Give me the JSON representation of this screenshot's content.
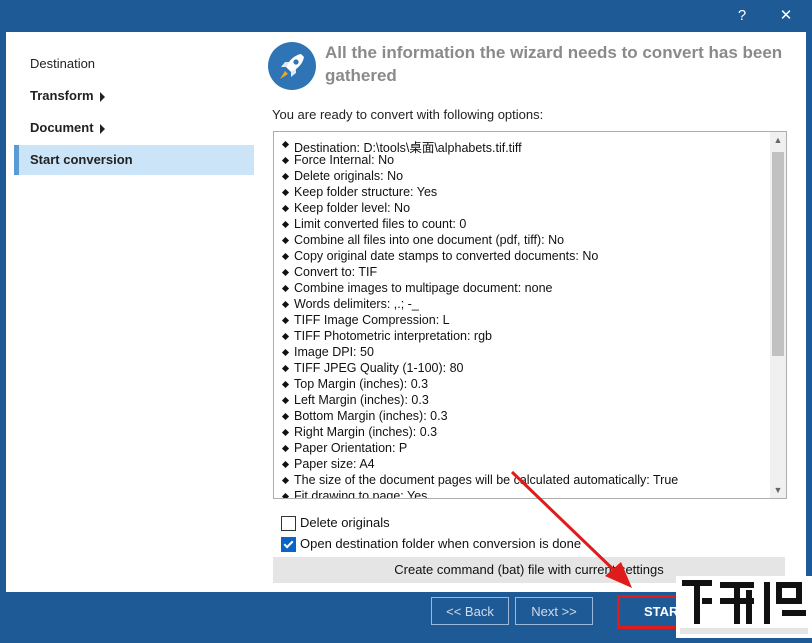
{
  "window": {
    "help_label": "?",
    "close_label": "✕"
  },
  "sidebar": {
    "items": [
      {
        "label": "Destination"
      },
      {
        "label": "Transform"
      },
      {
        "label": "Document"
      },
      {
        "label": "Start conversion"
      }
    ]
  },
  "main": {
    "heading": "All the information the wizard needs to convert has been gathered",
    "subheading": "You are ready to convert with following options:",
    "options": [
      "Destination: D:\\tools\\桌面\\alphabets.tif.tiff",
      "Force Internal: No",
      "Delete originals: No",
      "Keep folder structure: Yes",
      "Keep folder level: No",
      "Limit converted files to count: 0",
      "Combine all files into one document (pdf, tiff): No",
      "Copy original date stamps to converted documents: No",
      "Convert to: TIF",
      "Combine images to multipage document: none",
      "Words delimiters: ,.; -_",
      "TIFF Image Compression: L",
      "TIFF Photometric interpretation: rgb",
      "Image DPI: 50",
      "TIFF JPEG Quality (1-100): 80",
      "Top Margin (inches): 0.3",
      "Left Margin (inches): 0.3",
      "Bottom Margin (inches): 0.3",
      "Right Margin (inches): 0.3",
      "Paper Orientation: P",
      "Paper size: A4",
      "The size of the document pages will be calculated automatically: True",
      "Fit drawing to page: Yes"
    ],
    "delete_originals_label": "Delete originals",
    "delete_originals_checked": false,
    "open_folder_label": "Open destination folder when conversion is done",
    "open_folder_checked": true,
    "bat_button_label": "Create command (bat) file with current settings"
  },
  "footer": {
    "back_label": "<< Back",
    "next_label": "Next >>",
    "start_label": "START"
  },
  "colors": {
    "frame": "#1e5a96",
    "active_item_bg": "#cce4f7",
    "highlight": "#e01b1b"
  },
  "icons": [
    "rocket-icon",
    "chevron-right-icon",
    "checkbox-icon",
    "scroll-up-icon",
    "scroll-down-icon",
    "help-icon",
    "close-icon"
  ]
}
